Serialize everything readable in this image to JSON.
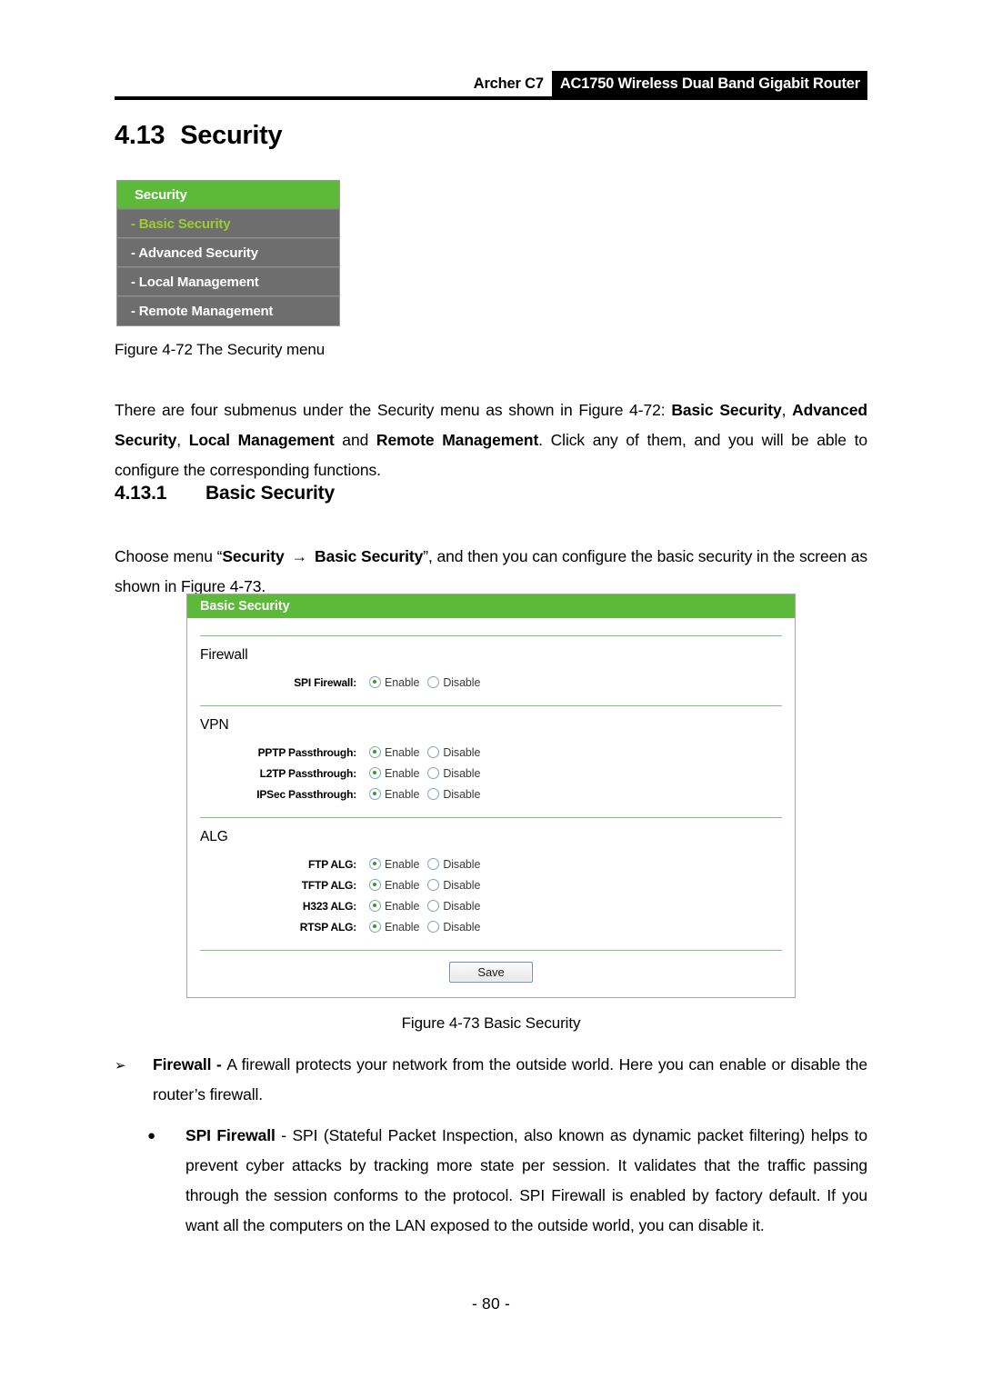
{
  "header": {
    "model": "Archer C7",
    "product": "AC1750 Wireless Dual Band Gigabit Router"
  },
  "section": {
    "number": "4.13",
    "title": "Security"
  },
  "subsection": {
    "number": "4.13.1",
    "title": "Basic Security"
  },
  "security_menu": {
    "header_label": "Security",
    "items": [
      {
        "label": "- Basic Security",
        "active": true
      },
      {
        "label": "- Advanced Security",
        "active": false
      },
      {
        "label": "- Local Management",
        "active": false
      },
      {
        "label": "- Remote Management",
        "active": false
      }
    ]
  },
  "captions": {
    "figure_72": "Figure 4-72 The Security menu",
    "figure_73": "Figure 4-73 Basic Security"
  },
  "paragraphs": {
    "intro_1": "There are four submenus under the Security menu as shown in Figure 4-72: ",
    "intro_b1": "Basic Security",
    "intro_2": ", ",
    "intro_b2": "Advanced Security",
    "intro_3": ", ",
    "intro_b3": "Local Management",
    "intro_4": " and ",
    "intro_b4": "Remote Management",
    "intro_5": ". Click any of them, and you will be able to configure the corresponding functions.",
    "choose_1": "Choose menu “",
    "choose_b1": "Security",
    "choose_arrow": "→",
    "choose_b2": "Basic Security",
    "choose_2": "”, and then you can configure the basic security in the screen as shown in Figure 4-73."
  },
  "basic_security_panel": {
    "title": "Basic Security",
    "sections": [
      {
        "heading": "Firewall",
        "fields": [
          {
            "label": "SPI Firewall:",
            "selected": "Enable"
          }
        ]
      },
      {
        "heading": "VPN",
        "fields": [
          {
            "label": "PPTP Passthrough:",
            "selected": "Enable"
          },
          {
            "label": "L2TP Passthrough:",
            "selected": "Enable"
          },
          {
            "label": "IPSec Passthrough:",
            "selected": "Enable"
          }
        ]
      },
      {
        "heading": "ALG",
        "fields": [
          {
            "label": "FTP ALG:",
            "selected": "Enable"
          },
          {
            "label": "TFTP ALG:",
            "selected": "Enable"
          },
          {
            "label": "H323 ALG:",
            "selected": "Enable"
          },
          {
            "label": "RTSP ALG:",
            "selected": "Enable"
          }
        ]
      }
    ],
    "radio_options": [
      "Enable",
      "Disable"
    ],
    "save_label": "Save"
  },
  "bullets": {
    "firewall_marker": "➢",
    "firewall_term": "Firewall - ",
    "firewall_text": "A firewall protects your network from the outside world. Here you can enable or disable the router’s firewall.",
    "spi_marker": "●",
    "spi_term": "SPI Firewall",
    "spi_text": " - SPI (Stateful Packet Inspection, also known as dynamic packet filtering) helps to prevent cyber attacks by tracking more state per session. It validates that the traffic passing through the session conforms to the protocol. SPI Firewall is enabled by factory default. If you want all the computers on the LAN exposed to the outside world, you can disable it."
  },
  "footer": {
    "page_number": "- 80 -"
  },
  "colors": {
    "accent_green": "#5cb93a",
    "menu_gray": "#6e6e6e",
    "active_item_green": "#9bce2e",
    "section_rule_green": "#7fbf7f"
  }
}
